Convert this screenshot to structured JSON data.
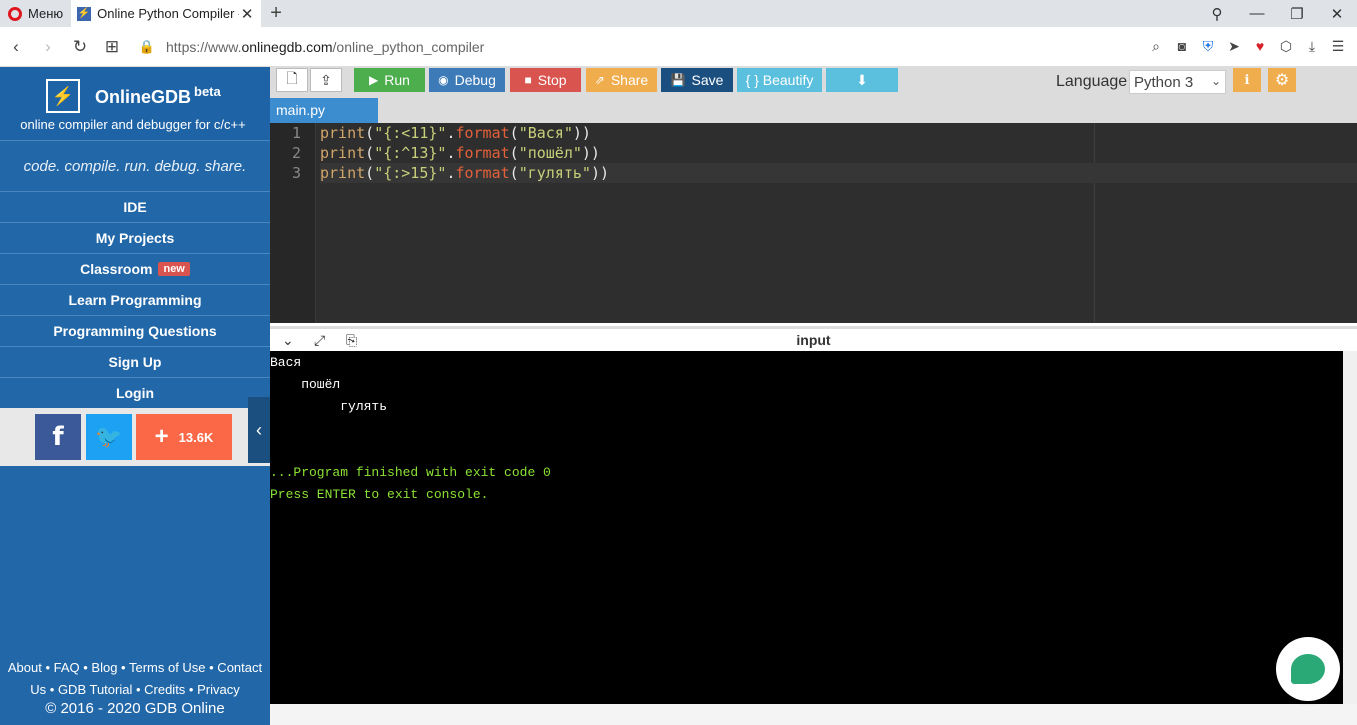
{
  "browser": {
    "menu_label": "Меню",
    "tab_title": "Online Python Compiler - c",
    "favicon_glyph": "⚡",
    "new_tab": "+",
    "url_prefix": "https://www.",
    "url_host": "onlinegdb.com",
    "url_path": "/online_python_compiler"
  },
  "sidebar": {
    "brand_name": "OnlineGDB",
    "brand_beta": "beta",
    "brand_sub": "online compiler and debugger for c/c++",
    "tagline": "code. compile. run. debug. share.",
    "items": [
      {
        "label": "IDE"
      },
      {
        "label": "My Projects"
      },
      {
        "label": "Classroom",
        "badge": "new"
      },
      {
        "label": "Learn Programming"
      },
      {
        "label": "Programming Questions"
      },
      {
        "label": "Sign Up"
      },
      {
        "label": "Login"
      }
    ],
    "social": {
      "facebook": "f",
      "twitter": "🐦",
      "share_count": "13.6K"
    },
    "footer_line1": "About • FAQ • Blog • Terms of Use • Contact",
    "footer_line2": "Us • GDB Tutorial • Credits • Privacy",
    "copyright": "© 2016 - 2020 GDB Online"
  },
  "toolbar": {
    "run": "Run",
    "debug": "Debug",
    "stop": "Stop",
    "share": "Share",
    "save": "Save",
    "beautify": "{ } Beautify",
    "language_label": "Language",
    "language_value": "Python 3"
  },
  "editor": {
    "file_tab": "main.py",
    "lines": [
      {
        "num": "1",
        "fmt": "\"{:<11}\"",
        "arg": "\"Вася\"",
        "close": "))"
      },
      {
        "num": "2",
        "fmt": "\"{:^13}\"",
        "arg": "\"пошёл\"",
        "close": "))"
      },
      {
        "num": "3",
        "fmt": "\"{:>15}\"",
        "arg": "\"гулять\"",
        "close": "))"
      }
    ]
  },
  "console": {
    "title": "input",
    "output": [
      "Вася",
      "    пошёл",
      "         гулять"
    ],
    "finish_line": "...Program finished with exit code 0",
    "exit_line": "Press ENTER to exit console."
  },
  "colors": {
    "sidebar_bg": "#2267a8",
    "run": "#4cae4c",
    "debug": "#3d7ab8",
    "stop": "#d9534f",
    "share": "#f0ad4e",
    "save": "#1b4f80",
    "beautify": "#5bc0de",
    "console_green": "#8ae234"
  }
}
